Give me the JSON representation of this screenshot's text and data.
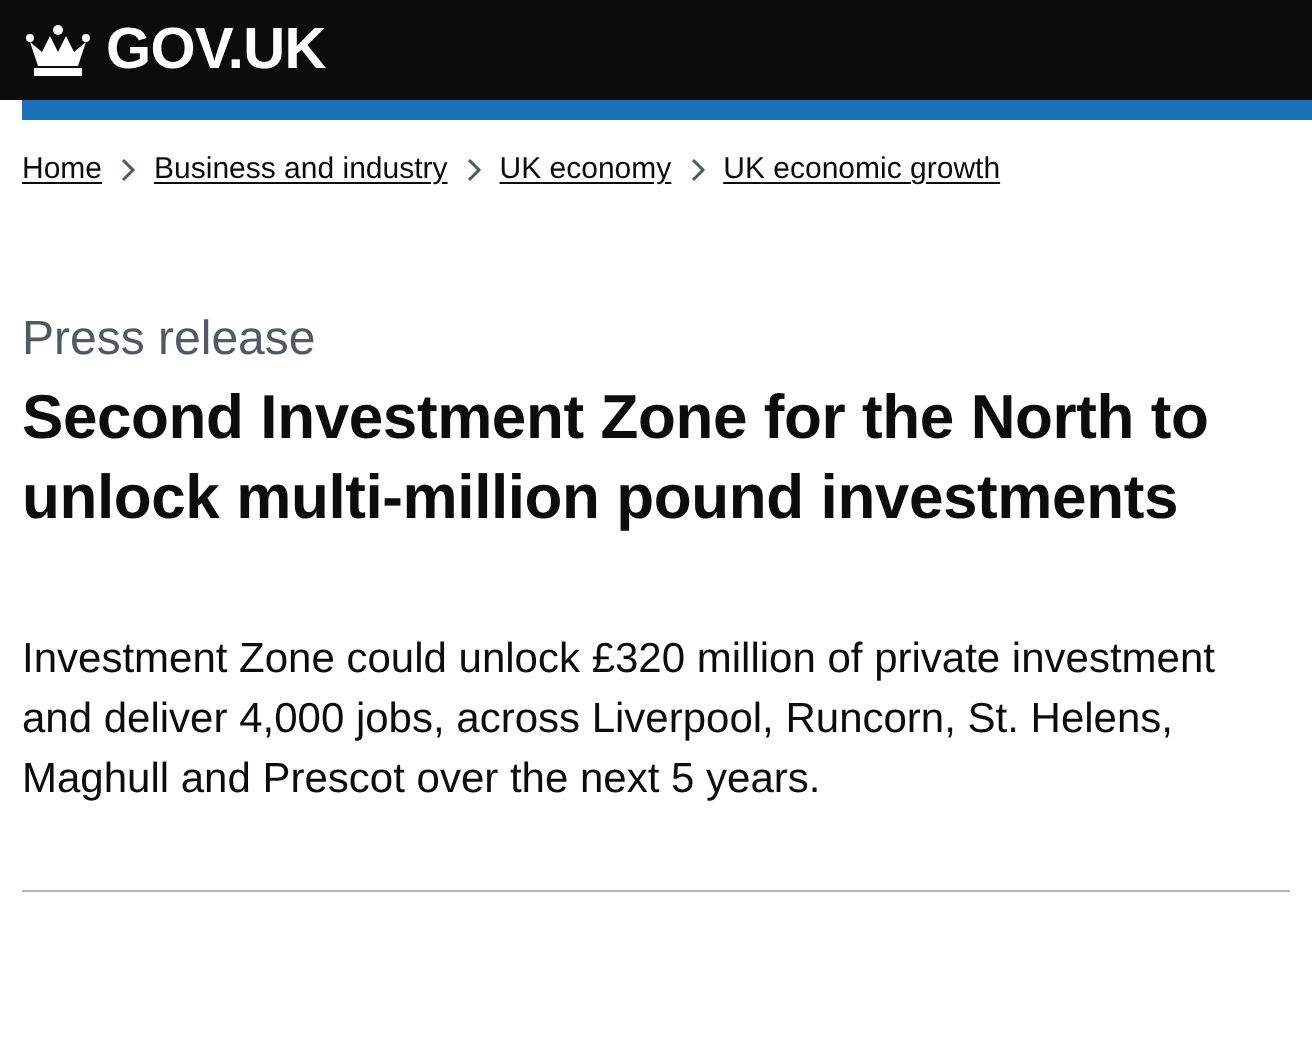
{
  "header": {
    "logo": "GOV.UK"
  },
  "breadcrumbs": [
    {
      "label": "Home"
    },
    {
      "label": "Business and industry"
    },
    {
      "label": "UK economy"
    },
    {
      "label": "UK economic growth"
    }
  ],
  "document_type": "Press release",
  "title": "Second Investment Zone for the North to unlock multi-million pound investments",
  "summary": "Investment Zone could unlock £320 million of private investment and deliver 4,000 jobs, across Liverpool, Runcorn, St. Helens, Maghull and Prescot over the next 5 years."
}
